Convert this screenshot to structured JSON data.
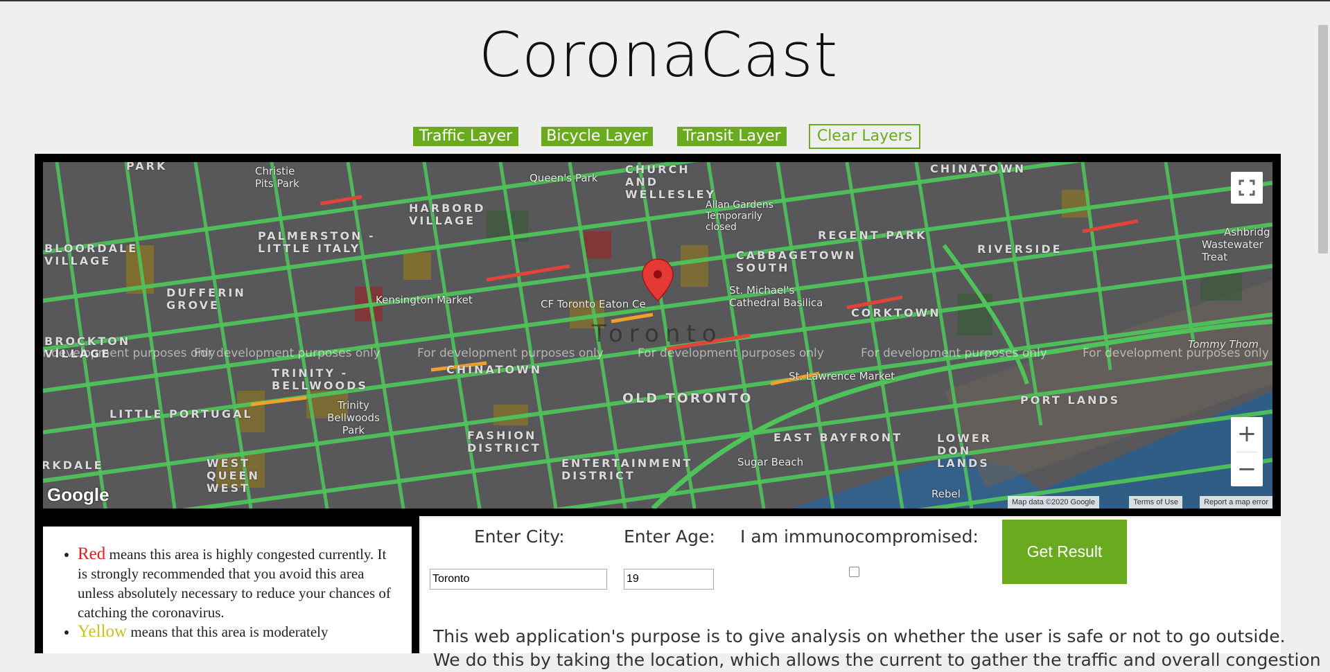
{
  "app": {
    "title": "CoronaCast"
  },
  "layers": {
    "traffic": "Traffic Layer",
    "bicycle": "Bicycle Layer",
    "transit": "Transit Layer",
    "clear": "Clear Layers"
  },
  "map": {
    "city_label": "Toronto",
    "watermark": "For development purposes only",
    "neighbourhoods": [
      "PARK",
      "CHURCH AND WELLESLEY",
      "CHINATOWN",
      "HARBORD VILLAGE",
      "PALMERSTON - LITTLE ITALY",
      "BLOORDALE VILLAGE",
      "DUFFERIN GROVE",
      "REGENT PARK",
      "CABBAGETOWN SOUTH",
      "RIVERSIDE",
      "CORKTOWN",
      "BROCKTON VILLAGE",
      "TRINITY - BELLWOODS",
      "CHINATOWN",
      "OLD TORONTO",
      "LITTLE PORTUGAL",
      "EAST BAYFRONT",
      "PORT LANDS",
      "LOWER DON LANDS",
      "FASHION DISTRICT",
      "WEST QUEEN WEST",
      "ENTERTAINMENT DISTRICT",
      "RKDALE"
    ],
    "pois": [
      "Christie Pits Park",
      "Queen's Park",
      "Allan Gardens Temporarily closed",
      "Kensington Market",
      "CF Toronto Eaton Ce",
      "St. Michael's Cathedral Basilica",
      "St. Lawrence Market",
      "Trinity Bellwoods Park",
      "Sugar Beach",
      "Rebel",
      "Tommy Thom",
      "Ashbridg",
      "Wastewater Treat"
    ],
    "footer": {
      "map_data": "Map data ©2020 Google",
      "terms": "Terms of Use",
      "report": "Report a map error"
    },
    "google": "Google",
    "zoom_in": "+",
    "zoom_out": "−"
  },
  "legend": {
    "red_word": "Red",
    "red_text": " means this area is highly congested currently. It is strongly recommended that you avoid this area unless absolutely necessary to reduce your chances of catching the coronavirus.",
    "yellow_word": "Yellow",
    "yellow_text": " means that this area is moderately",
    "red_color": "#e0201b",
    "yellow_color": "#c8c21e"
  },
  "form": {
    "city_label": "Enter City:",
    "age_label": "Enter Age:",
    "immuno_label": "I am immunocompromised:",
    "city_value": "Toronto",
    "age_value": "19",
    "immuno_checked": false,
    "submit": "Get Result"
  },
  "description": {
    "line1": "This web application's purpose is to give analysis on whether the user is safe or not to go outside.",
    "line2": "We do this by taking the location, which allows the current to gather the traffic and overall congestion"
  },
  "colors": {
    "accent": "#6aaa1e",
    "frame": "#000000",
    "page_bg": "#efefef"
  }
}
